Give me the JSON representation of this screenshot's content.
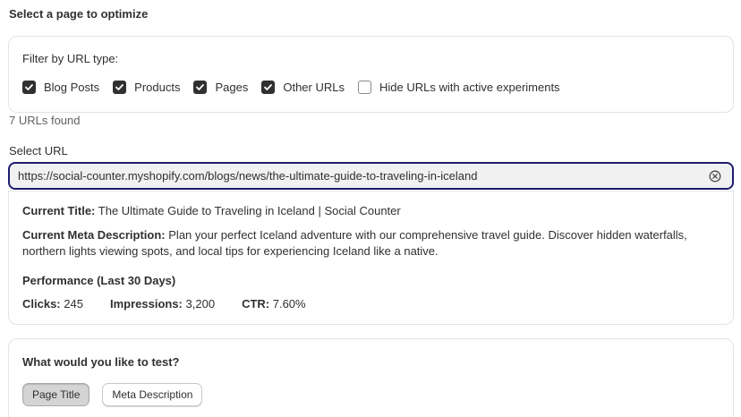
{
  "page": {
    "heading": "Select a page to optimize"
  },
  "filter": {
    "label": "Filter by URL type:",
    "options": [
      {
        "label": "Blog Posts",
        "checked": true
      },
      {
        "label": "Products",
        "checked": true
      },
      {
        "label": "Pages",
        "checked": true
      },
      {
        "label": "Other URLs",
        "checked": true
      },
      {
        "label": "Hide URLs with active experiments",
        "checked": false
      }
    ]
  },
  "results": {
    "count_text": "7 URLs found"
  },
  "url_select": {
    "label": "Select URL",
    "value": "https://social-counter.myshopify.com/blogs/news/the-ultimate-guide-to-traveling-in-iceland"
  },
  "details": {
    "title_label": "Current Title:",
    "title_value": "The Ultimate Guide to Traveling in Iceland | Social Counter",
    "meta_label": "Current Meta Description:",
    "meta_value_line1": "Plan your perfect Iceland adventure with our comprehensive travel guide. Discover hidden waterfalls,",
    "meta_value_line2": "northern lights viewing spots, and local tips for experiencing Iceland like a native.",
    "performance_heading": "Performance (Last 30 Days)",
    "clicks_label": "Clicks:",
    "clicks_value": "245",
    "impressions_label": "Impressions:",
    "impressions_value": "3,200",
    "ctr_label": "CTR:",
    "ctr_value": "7.60%"
  },
  "test": {
    "heading": "What would you like to test?",
    "options": [
      {
        "label": "Page Title",
        "selected": true
      },
      {
        "label": "Meta Description",
        "selected": false
      }
    ]
  },
  "colors": {
    "focus_border": "#1e1b6e",
    "checkbox_checked": "#303030",
    "text": "#303030"
  }
}
